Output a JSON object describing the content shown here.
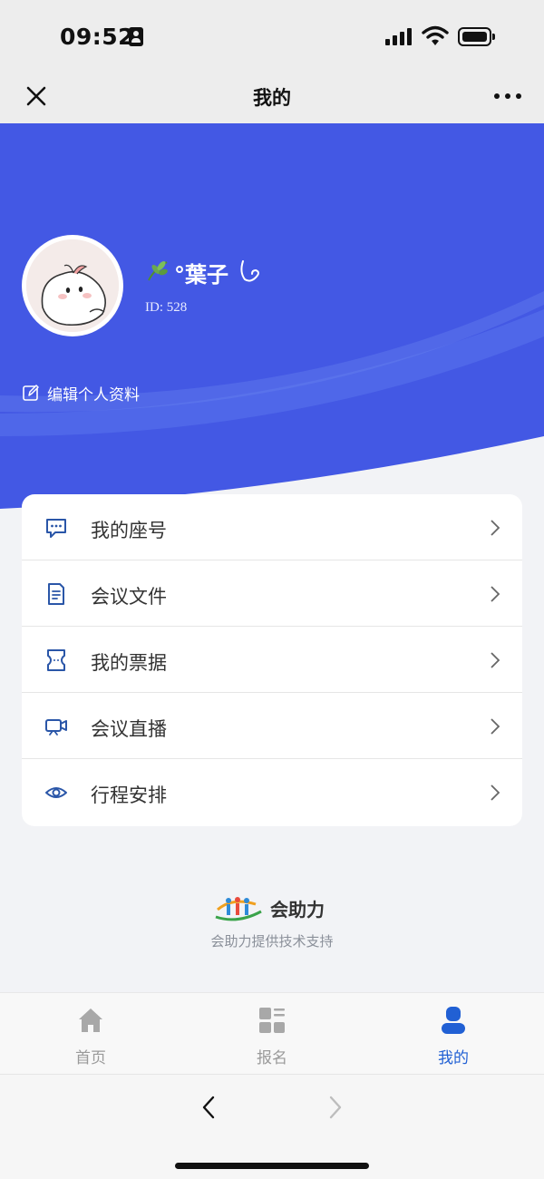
{
  "status_bar": {
    "time": "09:52"
  },
  "nav": {
    "title": "我的"
  },
  "profile": {
    "name": "°葉子",
    "id_text": "ID: 528",
    "edit_label": "编辑个人资料"
  },
  "menu": [
    {
      "label": "我的座号",
      "icon": "chat-bubble-icon"
    },
    {
      "label": "会议文件",
      "icon": "document-icon"
    },
    {
      "label": "我的票据",
      "icon": "ticket-icon"
    },
    {
      "label": "会议直播",
      "icon": "video-camera-icon"
    },
    {
      "label": "行程安排",
      "icon": "eye-icon"
    }
  ],
  "brand": {
    "logo_text": "会助力",
    "support_text": "会助力提供技术支持"
  },
  "tabs": [
    {
      "label": "首页",
      "icon": "home-icon",
      "active": false
    },
    {
      "label": "报名",
      "icon": "grid-icon",
      "active": false
    },
    {
      "label": "我的",
      "icon": "user-icon",
      "active": true
    }
  ],
  "colors": {
    "hero": "#4358e4",
    "active_tab": "#2160d4",
    "menu_icon": "#2a56a8"
  }
}
